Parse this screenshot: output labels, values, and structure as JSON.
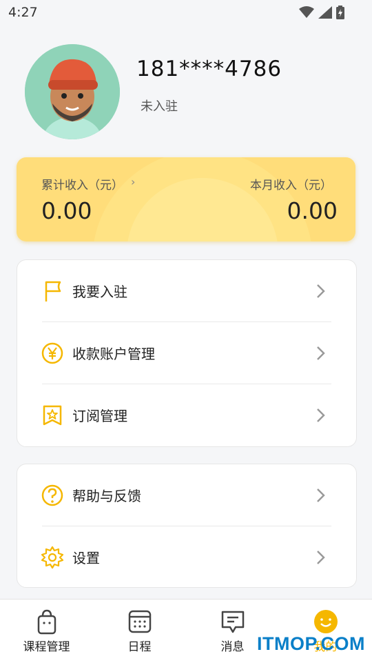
{
  "status_bar": {
    "time": "4:27",
    "icons": [
      "wifi-icon",
      "signal-icon",
      "battery-icon"
    ]
  },
  "profile": {
    "phone": "181****4786",
    "status": "未入驻",
    "avatar_icon": "user-avatar"
  },
  "income": {
    "total_label": "累计收入（元）",
    "total_value": "0.00",
    "month_label": "本月收入（元）",
    "month_value": "0.00",
    "card_color": "#ffdd7a"
  },
  "menu_group1": [
    {
      "label": "我要入驻",
      "icon": "flag-icon"
    },
    {
      "label": "收款账户管理",
      "icon": "yuan-icon"
    },
    {
      "label": "订阅管理",
      "icon": "star-badge-icon"
    }
  ],
  "menu_group2": [
    {
      "label": "帮助与反馈",
      "icon": "help-icon"
    },
    {
      "label": "设置",
      "icon": "gear-icon"
    }
  ],
  "bottom_nav": [
    {
      "label": "课程管理",
      "icon": "bag-icon"
    },
    {
      "label": "日程",
      "icon": "calendar-icon"
    },
    {
      "label": "消息",
      "icon": "message-icon"
    },
    {
      "label": "我的",
      "icon": "smile-icon",
      "active": true
    }
  ],
  "watermark": "ITMOP.COM",
  "accent_color": "#f5b700"
}
